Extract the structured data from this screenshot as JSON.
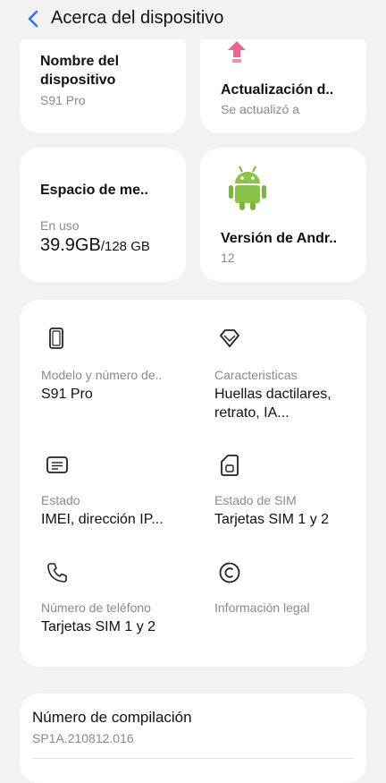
{
  "header": {
    "title": "Acerca del dispositivo",
    "back_icon": "chevron-left-icon"
  },
  "cards": {
    "device_name": {
      "label": "Nombre del dispositivo",
      "value": "S91 Pro"
    },
    "update": {
      "label": "Actualización d..",
      "value": "Se actualizó a",
      "icon": "update-arrow-icon"
    },
    "storage": {
      "label": "Espacio de me..",
      "caption": "En uso",
      "used": "39.9GB",
      "total": "/128 GB"
    },
    "android": {
      "label": "Versión de Andr..",
      "value": "12",
      "icon": "android-robot-icon"
    }
  },
  "grid": {
    "model": {
      "label": "Modelo y número de..",
      "value": "S91 Pro",
      "icon": "phone-icon"
    },
    "features": {
      "label": "Caracteristicas",
      "value": "Huellas dactilares, retrato, IA...",
      "icon": "diamond-icon"
    },
    "status": {
      "label": "Estado",
      "value": "IMEI, dirección IP...",
      "icon": "document-icon"
    },
    "sim": {
      "label": "Estado de SIM",
      "value": "Tarjetas SIM 1 y 2",
      "icon": "sim-card-icon"
    },
    "phone_number": {
      "label": "Número de teléfono",
      "value": "Tarjetas SIM 1 y 2",
      "icon": "phone-handset-icon"
    },
    "legal": {
      "label": "Información legal",
      "icon": "copyright-icon"
    }
  },
  "build": {
    "label": "Número de compilación",
    "value": "SP1A.210812.016"
  },
  "colors": {
    "accent": "#2f6fe6",
    "android_green": "#8bc34a",
    "update_pink": "#f06292",
    "background": "#f2f2f2"
  }
}
